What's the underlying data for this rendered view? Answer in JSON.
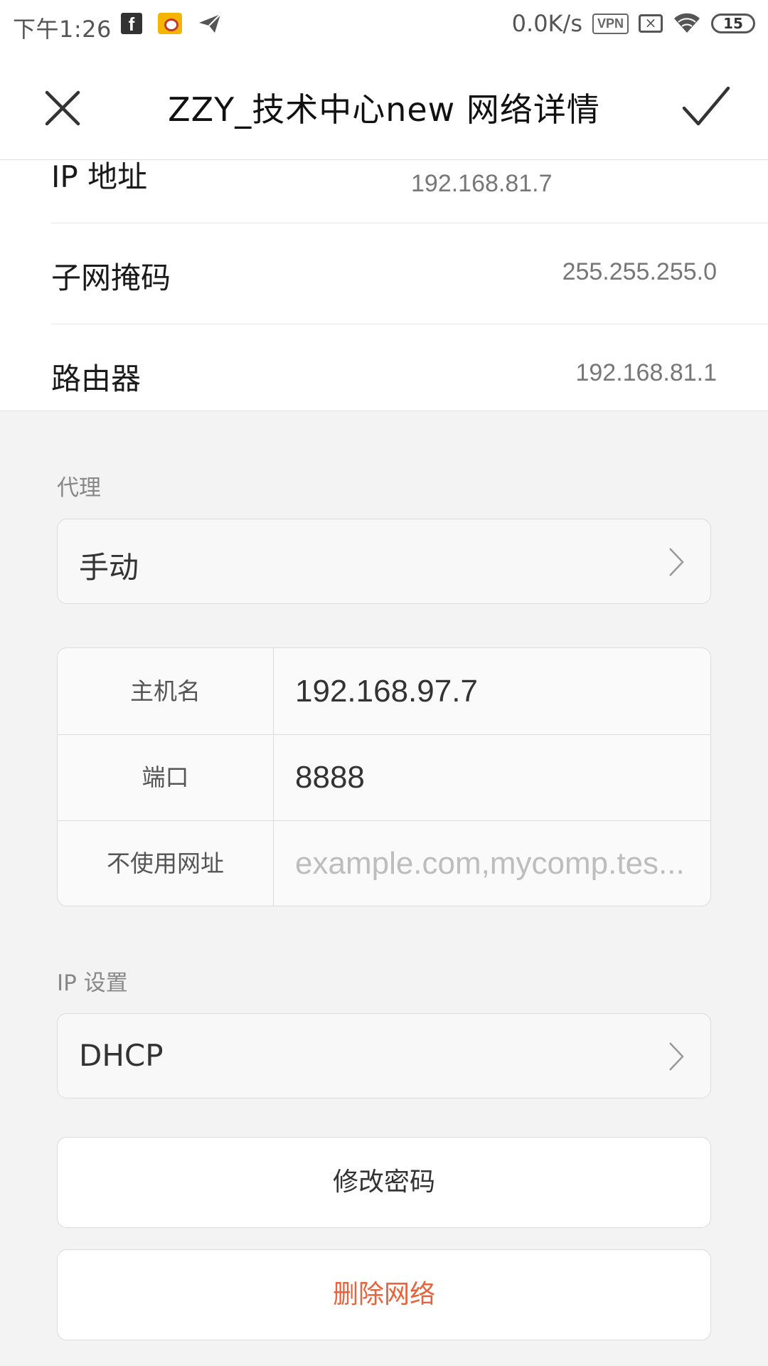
{
  "status_bar": {
    "time": "下午1:26",
    "net_speed": "0.0K/s",
    "vpn": "VPN",
    "battery": "15",
    "icons": [
      "facebook-icon",
      "weibo-icon",
      "paper-plane-icon",
      "vpn-icon",
      "sim-off-icon",
      "wifi-icon",
      "battery-icon"
    ]
  },
  "app_bar": {
    "title": "ZZY_技术中心new  网络详情"
  },
  "info": {
    "ip_label": "IP 地址",
    "ip_value": "192.168.81.7",
    "subnet_label": "子网掩码",
    "subnet_value": "255.255.255.0",
    "router_label": "路由器",
    "router_value": "192.168.81.1"
  },
  "proxy": {
    "section_label": "代理",
    "mode": "手动",
    "rows": [
      {
        "label": "主机名",
        "value": "192.168.97.7"
      },
      {
        "label": "端口",
        "value": "8888"
      },
      {
        "label": "不使用网址",
        "placeholder": "example.com,mycomp.tes..."
      }
    ]
  },
  "ip_settings": {
    "section_label": "IP 设置",
    "mode": "DHCP"
  },
  "actions": {
    "modify_password": "修改密码",
    "delete_network": "删除网络"
  },
  "colors": {
    "accent_delete": "#e8623c",
    "background": "#f3f3f3"
  }
}
